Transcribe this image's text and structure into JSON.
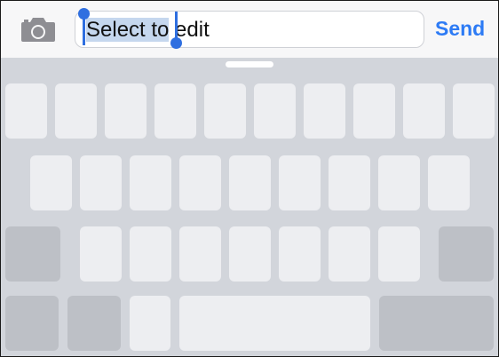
{
  "message_bar": {
    "camera_icon": "camera-icon",
    "input": {
      "selected_text": "Select to",
      "rest_text": " edit"
    },
    "send_label": "Send",
    "accent_color": "#2d7bf5",
    "selection_color": "#c5d7ee"
  },
  "keyboard": {
    "state": "blank keys, labels not shown",
    "row_key_counts": [
      10,
      9,
      9,
      5
    ]
  }
}
